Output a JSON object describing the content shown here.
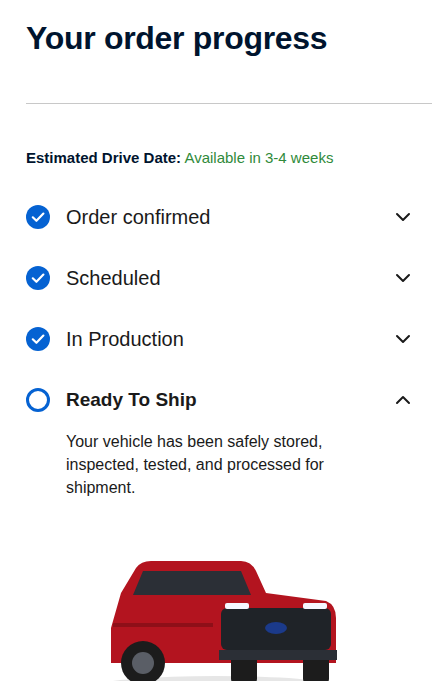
{
  "page": {
    "title": "Your order progress"
  },
  "estimate": {
    "label": "Estimated Drive Date:",
    "value": "Available in 3-4 weeks"
  },
  "steps": [
    {
      "label": "Order confirmed",
      "completed": true,
      "expanded": false
    },
    {
      "label": "Scheduled",
      "completed": true,
      "expanded": false
    },
    {
      "label": "In Production",
      "completed": true,
      "expanded": false
    },
    {
      "label": "Ready To Ship",
      "completed": false,
      "expanded": true,
      "description": "Your vehicle has been safely stored, inspected, tested, and processed for shipment."
    }
  ]
}
